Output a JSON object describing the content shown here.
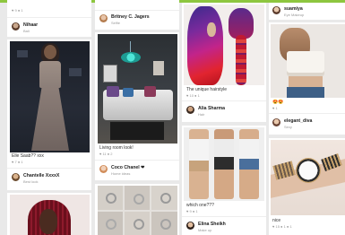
{
  "colors": {
    "accent": "#8dc63f",
    "background": "#e9e9e9"
  },
  "cards": {
    "c1": {
      "stats": "♥ 9 ● 1",
      "user": "Nihaar",
      "sub": "Bali"
    },
    "c2": {
      "user": "Britney C. Jagers",
      "sub": "Selfie"
    },
    "c3": {
      "user": "suamiya",
      "sub": "Eye Makeup"
    },
    "c4": {
      "caption": "Elle Saab?? xxx",
      "stats": "♥ 7 ● 1",
      "user": "Chantelle XxxxX",
      "sub": "Best look"
    },
    "c5": {
      "caption": "Living room look!",
      "stats": "♥ 11 ● 2",
      "user": "Coco Chanel ❤",
      "sub": "Home ideas"
    },
    "c6": {
      "caption": "The unique hairstyle",
      "stats": "♥ 10 ● 1",
      "user": "Alia Sharma",
      "sub": "Hair"
    },
    "c7": {
      "caption": "😍😍",
      "stats": "♥ 1",
      "user": "elegant_diva",
      "sub": "Sexy"
    },
    "c8": {
      "caption": "which one???",
      "stats": "♥ 9 ● 1",
      "user": "Elina Sheikh",
      "sub": "Make up"
    },
    "c9": {
      "caption": "nice",
      "stats": "♥ 15 ● 1 ● 1"
    }
  }
}
